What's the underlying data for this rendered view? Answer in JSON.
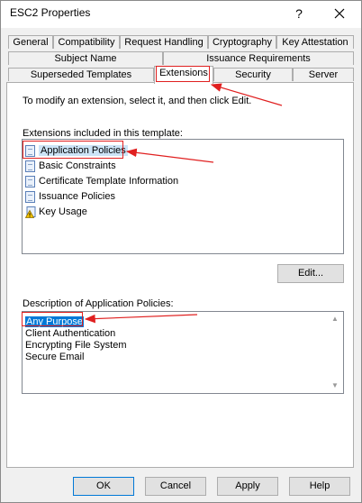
{
  "window": {
    "title": "ESC2 Properties",
    "help_label": "?",
    "close_label": "✕"
  },
  "tabs": {
    "row1": [
      "General",
      "Compatibility",
      "Request Handling",
      "Cryptography",
      "Key Attestation"
    ],
    "row2": [
      "Subject Name",
      "Issuance Requirements"
    ],
    "row3": [
      "Superseded Templates",
      "Extensions",
      "Security",
      "Server"
    ],
    "active": "Extensions"
  },
  "panel": {
    "instruction": "To modify an extension, select it, and then click Edit.",
    "extensions_label": "Extensions included in this template:",
    "extensions": [
      {
        "label": "Application Policies",
        "icon": "document-icon",
        "selected": true
      },
      {
        "label": "Basic Constraints",
        "icon": "document-icon",
        "selected": false
      },
      {
        "label": "Certificate Template Information",
        "icon": "document-icon",
        "selected": false
      },
      {
        "label": "Issuance Policies",
        "icon": "document-icon",
        "selected": false
      },
      {
        "label": "Key Usage",
        "icon": "warning-document-icon",
        "selected": false
      }
    ],
    "edit_button": "Edit...",
    "description_label": "Description of Application Policies:",
    "description_lines": [
      "Any Purpose",
      "Client Authentication",
      "Encrypting File System",
      "Secure Email"
    ]
  },
  "buttons": {
    "ok": "OK",
    "cancel": "Cancel",
    "apply": "Apply",
    "help": "Help"
  },
  "colors": {
    "annotation": "#e02020",
    "selection": "#0078d7",
    "selection_light": "#cce4f7"
  }
}
